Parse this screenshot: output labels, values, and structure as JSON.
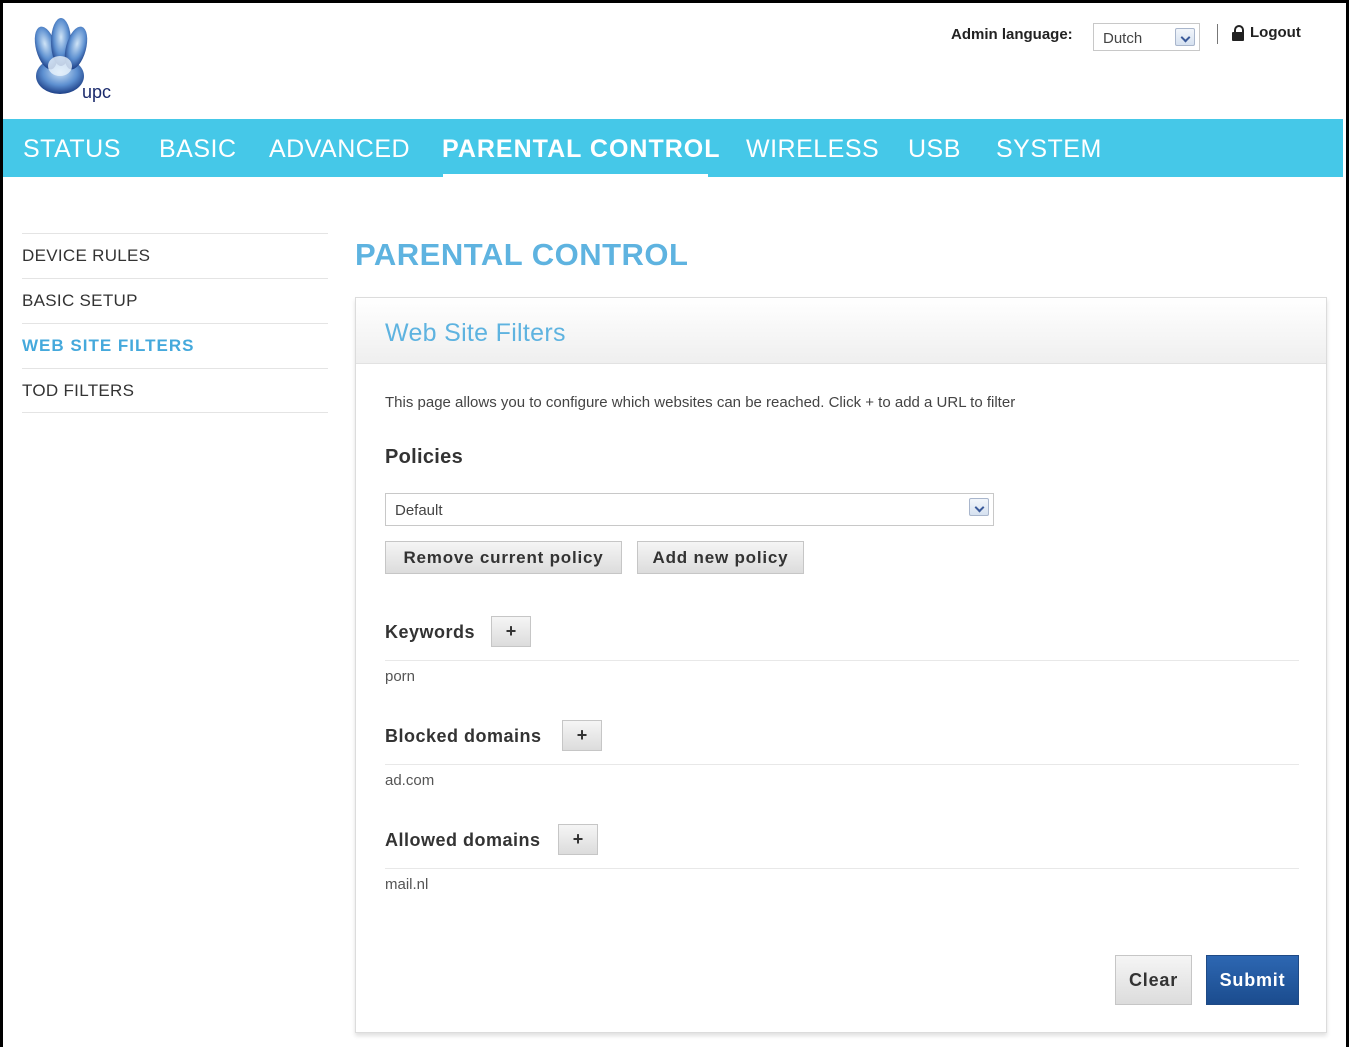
{
  "header": {
    "logo_text": "upc",
    "admin_language_label": "Admin language:",
    "language_selected": "Dutch",
    "logout_label": "Logout"
  },
  "nav": {
    "items": [
      "STATUS",
      "BASIC",
      "ADVANCED",
      "PARENTAL CONTROL",
      "WIRELESS",
      "USB",
      "SYSTEM"
    ],
    "active": "PARENTAL CONTROL"
  },
  "sidebar": {
    "items": [
      "DEVICE RULES",
      "BASIC SETUP",
      "WEB SITE FILTERS",
      "TOD FILTERS"
    ],
    "active": "WEB SITE FILTERS"
  },
  "main": {
    "page_title": "PARENTAL CONTROL",
    "panel_title": "Web Site Filters",
    "description": "This page allows you to configure which websites can be reached. Click + to add a URL to filter",
    "policies_label": "Policies",
    "policy_selected": "Default",
    "remove_policy_label": "Remove current policy",
    "add_policy_label": "Add new policy",
    "plus_label": "+",
    "keywords": {
      "label": "Keywords",
      "entries": [
        "porn"
      ]
    },
    "blocked_domains": {
      "label": "Blocked domains",
      "entries": [
        "ad.com"
      ]
    },
    "allowed_domains": {
      "label": "Allowed domains",
      "entries": [
        "mail.nl"
      ]
    },
    "clear_label": "Clear",
    "submit_label": "Submit"
  },
  "colors": {
    "nav_bg": "#45c8e8",
    "title_blue": "#5eb3e0",
    "active_side": "#45a9dc",
    "submit_bg": "#1b4c8e"
  }
}
